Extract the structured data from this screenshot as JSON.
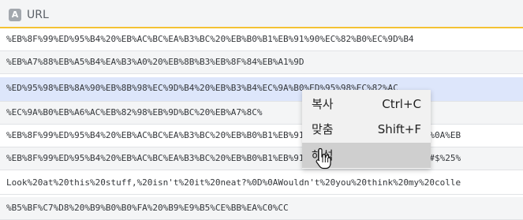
{
  "header": {
    "badge": "A",
    "column": "URL"
  },
  "rows": [
    "%EB%8F%99%ED%95%B4%20%EB%AC%BC%EA%B3%BC%20%EB%B0%B1%EB%91%90%EC%82%B0%EC%9D%B4",
    "%EB%A7%88%EB%A5%B4%EA%B3%A0%20%EB%8B%B3%EB%8F%84%EB%A1%9D",
    "%ED%95%98%EB%8A%90%EB%8B%98%EC%9D%B4%20%EB%B3%B4%EC%9A%B0%ED%95%98%EC%82%AC",
    "%EC%9A%B0%EB%A6%AC%EB%82%98%EB%9D%BC%20%EB%A7%8C%",
    "%EB%8F%99%ED%95%B4%20%EB%AC%BC%EA%B3%BC%20%EB%B0%B1%EB%91%90%EC%82%B0%EC%9D%B4%0D%0A%EB",
    "%EB%8F%99%ED%95%B4%20%EB%AC%BC%EA%B3%BC%20%EB%B0%B1%EB%91%90%EC%82%B0%EC%9D%B4~!@#$%25%",
    "Look%20at%20this%20stuff,%20isn't%20it%20neat?%0D%0AWouldn't%20you%20think%20my%20colle",
    "%B5%BF%C7%D8%20%B9%B0%B0%FA%20%B9%E9%B5%CE%BB%EA%C0%CC"
  ],
  "context_menu": {
    "items": [
      {
        "label": "복사",
        "shortcut": "Ctrl+C"
      },
      {
        "label": "맞춤",
        "shortcut": "Shift+F"
      },
      {
        "label": "해석",
        "shortcut": ""
      }
    ]
  },
  "colors": {
    "header_underline": "#f4c233",
    "selected_row": "#dde6fb",
    "menu_hover": "#cfcfcf"
  },
  "icons": {
    "cursor": "hand-pointer-cursor-icon"
  }
}
